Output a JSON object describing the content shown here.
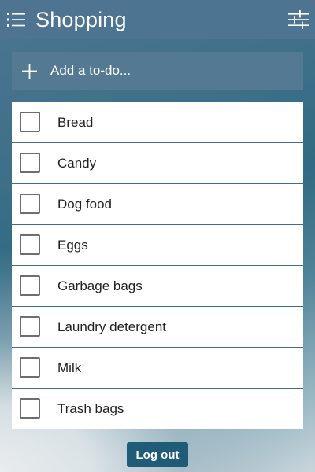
{
  "header": {
    "title": "Shopping",
    "menu_icon": "list-icon",
    "filter_icon": "filter-sliders-icon"
  },
  "add_todo": {
    "icon": "plus-icon",
    "label": "Add a to-do..."
  },
  "list": {
    "items": [
      {
        "label": "Bread",
        "checked": false
      },
      {
        "label": "Candy",
        "checked": false
      },
      {
        "label": "Dog food",
        "checked": false
      },
      {
        "label": "Eggs",
        "checked": false
      },
      {
        "label": "Garbage bags",
        "checked": false
      },
      {
        "label": "Laundry detergent",
        "checked": false
      },
      {
        "label": "Milk",
        "checked": false
      },
      {
        "label": "Trash bags",
        "checked": false
      }
    ]
  },
  "footer": {
    "logout_label": "Log out"
  },
  "colors": {
    "header_bg": "#4e7491",
    "add_bar_bg": "#557994",
    "logout_bg": "#1e5c78",
    "divider": "#3d7187"
  }
}
